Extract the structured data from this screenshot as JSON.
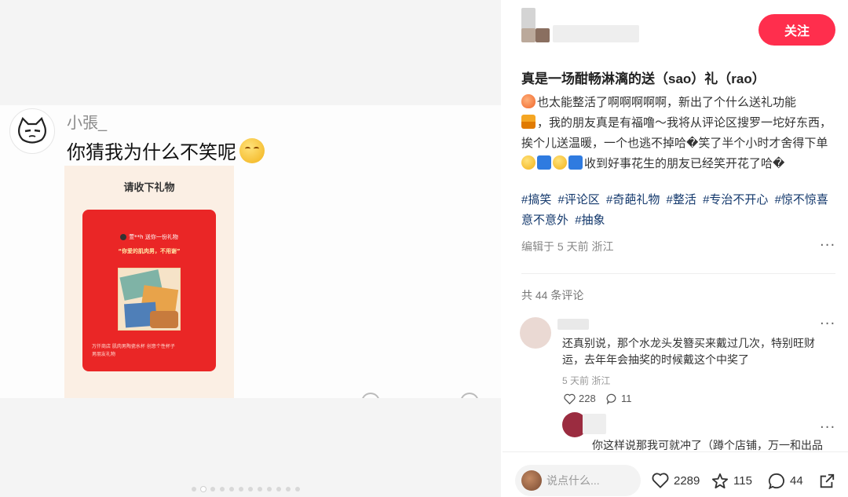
{
  "post_media": {
    "username": "小張_",
    "message": "你猜我为什么不笑呢",
    "gift_card": {
      "title": "请收下礼物",
      "sender": "萱**h 送你一份礼物",
      "quote": "“你爱的肌肉男，不用谢”",
      "footer_line1": "万仟商店 肌肉男陶瓷水杯 创意个性杯子",
      "footer_line2": "男朋友礼物"
    },
    "image_dots": 12,
    "active_dot": 1
  },
  "note": {
    "follow_label": "关注",
    "title": "真是一场酣畅淋漓的送（sao）礼（rao）",
    "body_part1": "也太能整活了啊啊啊啊啊，新出了个什么送礼功能",
    "body_part2": "，我的朋友真是有福噜～我将从评论区搜罗一坨好东西，挨个儿送温暖，一个也逃不掉哈�笑了半个小时才舍得下单",
    "body_part3": "收到好事花生的朋友已经笑开花了哈�",
    "tags": [
      "#搞笑",
      "#评论区",
      "#奇葩礼物",
      "#整活",
      "#专治不开心",
      "#惊不惊喜意不意外",
      "#抽象"
    ],
    "meta": "编辑于 5 天前 浙江",
    "more": "···"
  },
  "comments": {
    "count_label": "共 44 条评论",
    "items": [
      {
        "text": "还真别说，那个水龙头发簪买来戴过几次，特别旺财运，去年年会抽奖的时候戴这个中奖了",
        "meta": "5 天前 浙江",
        "likes": "228",
        "replies": "11",
        "more": "···"
      },
      {
        "text": "你这样说那我可就冲了（蹲个店铺，万一和出品",
        "more": "···"
      }
    ]
  },
  "bottom_bar": {
    "input_placeholder": "说点什么...",
    "likes": "2289",
    "collects": "115",
    "comments": "44"
  }
}
